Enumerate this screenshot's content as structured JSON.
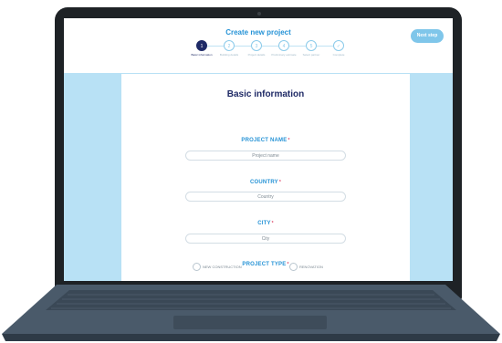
{
  "app": {
    "title": "Create new project",
    "next_button": "Next step"
  },
  "stepper": {
    "steps": [
      {
        "number": "1",
        "label": "Basic information",
        "active": true
      },
      {
        "number": "2",
        "label": "Building details",
        "active": false
      },
      {
        "number": "3",
        "label": "Project details",
        "active": false
      },
      {
        "number": "4",
        "label": "Preliminary estimate",
        "active": false
      },
      {
        "number": "5",
        "label": "Select partner",
        "active": false
      },
      {
        "number": "✓",
        "label": "Complete",
        "active": false
      }
    ]
  },
  "form": {
    "title": "Basic information",
    "required_mark": "*",
    "fields": {
      "project_name": {
        "label": "PROJECT NAME",
        "placeholder": "Project name"
      },
      "country": {
        "label": "COUNTRY",
        "placeholder": "Country"
      },
      "city": {
        "label": "CITY",
        "placeholder": "City"
      }
    },
    "project_type": {
      "label": "PROJECT TYPE",
      "options": [
        "NEW CONSTRUCTION",
        "RENOVATION"
      ]
    }
  },
  "colors": {
    "accent": "#2693d6",
    "title": "#1f2a66",
    "screen_bg": "#b8e1f5",
    "required": "#e04a6a"
  }
}
